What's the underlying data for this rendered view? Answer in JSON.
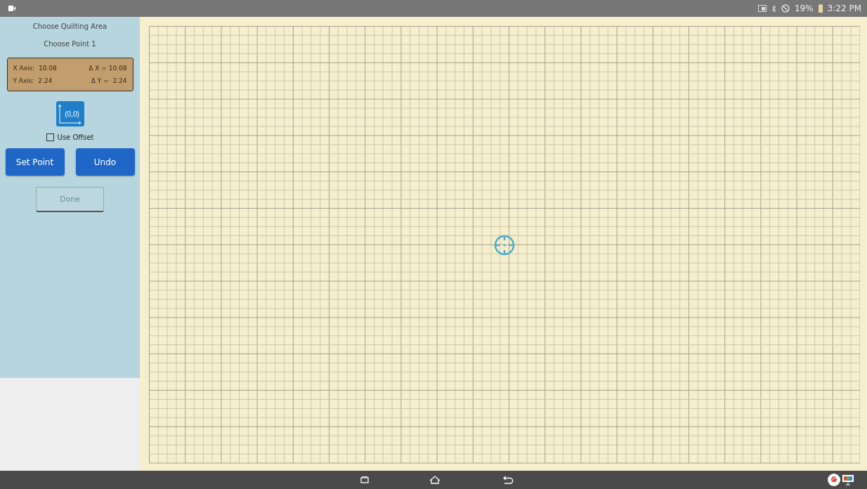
{
  "status_bar": {
    "battery": "19%",
    "time": "3:22 PM"
  },
  "panel": {
    "title": "Choose Quilting Area",
    "subtitle": "Choose Point 1",
    "readout": {
      "x_label": "X Axis:",
      "x_value": "10.08",
      "dx": "Δ X = 10.08",
      "y_label": "Y Axis:",
      "y_value": "2.24",
      "dy": "Δ Y =  2.24"
    },
    "origin_button": "(0,0)",
    "use_offset": {
      "label": "Use Offset",
      "checked": false
    },
    "buttons": [
      {
        "label": "Set Point",
        "disabled": false
      },
      {
        "label": "Undo",
        "disabled": false
      }
    ],
    "done": {
      "label": "Done",
      "disabled": true
    }
  }
}
